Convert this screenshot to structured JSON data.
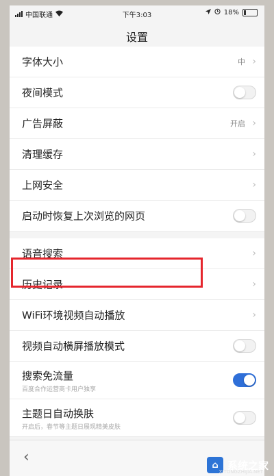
{
  "status_bar": {
    "carrier": "中国联通",
    "time": "下午3:03",
    "battery": "18%"
  },
  "title": "设置",
  "settings": [
    {
      "label": "字体大小",
      "value": "中"
    },
    {
      "label": "夜间模式"
    },
    {
      "label": "广告屏蔽",
      "value": "开启"
    },
    {
      "label": "清理缓存"
    },
    {
      "label": "上网安全"
    },
    {
      "label": "启动时恢复上次浏览的网页"
    },
    {
      "label": "语音搜索"
    },
    {
      "label": "历史记录"
    },
    {
      "label": "WiFi环境视频自动播放"
    },
    {
      "label": "视频自动横屏播放模式"
    },
    {
      "label": "搜索免流量",
      "sub": "百度合作运营商卡用户独享"
    },
    {
      "label": "主题日自动换肤",
      "sub": "开启后，春节等主题日展现精美皮肤"
    }
  ],
  "watermark": {
    "text": "系统之家",
    "domain": "XITONGZHIJIA.NET"
  },
  "colors": {
    "accent": "#2f6fd8",
    "highlight": "#e5262d"
  }
}
